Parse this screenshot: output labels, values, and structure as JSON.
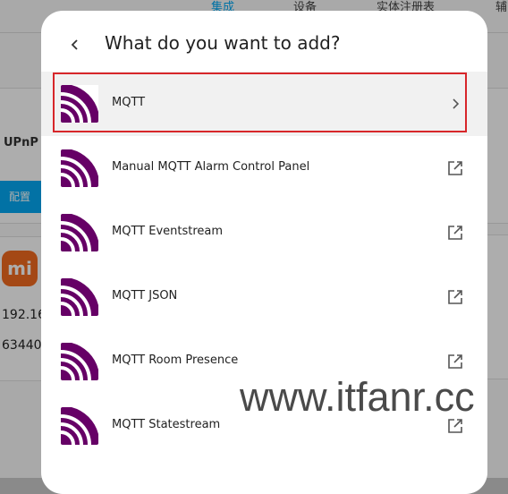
{
  "background": {
    "tabs": [
      "集成",
      "设备",
      "实体注册表",
      "辅"
    ],
    "upnp_logo": "UPnP",
    "config_button": "配置",
    "mi_logo": "mi",
    "ip_fragment": "192.16",
    "id_fragment": "63440"
  },
  "dialog": {
    "title": "What do you want to add?",
    "back_icon": "chevron-left-icon"
  },
  "items": [
    {
      "label": "MQTT",
      "end_icon": "chevron-right-icon",
      "selected": true
    },
    {
      "label": "Manual MQTT Alarm Control Panel",
      "end_icon": "open-in-new-icon"
    },
    {
      "label": "MQTT Eventstream",
      "end_icon": "open-in-new-icon"
    },
    {
      "label": "MQTT JSON",
      "end_icon": "open-in-new-icon"
    },
    {
      "label": "MQTT Room Presence",
      "end_icon": "open-in-new-icon"
    },
    {
      "label": "MQTT Statestream",
      "end_icon": "open-in-new-icon"
    }
  ],
  "colors": {
    "mqtt_brand": "#660066",
    "selection_outline": "#d7262a",
    "accent": "#03a9f4"
  },
  "watermark": "www.itfanr.cc"
}
